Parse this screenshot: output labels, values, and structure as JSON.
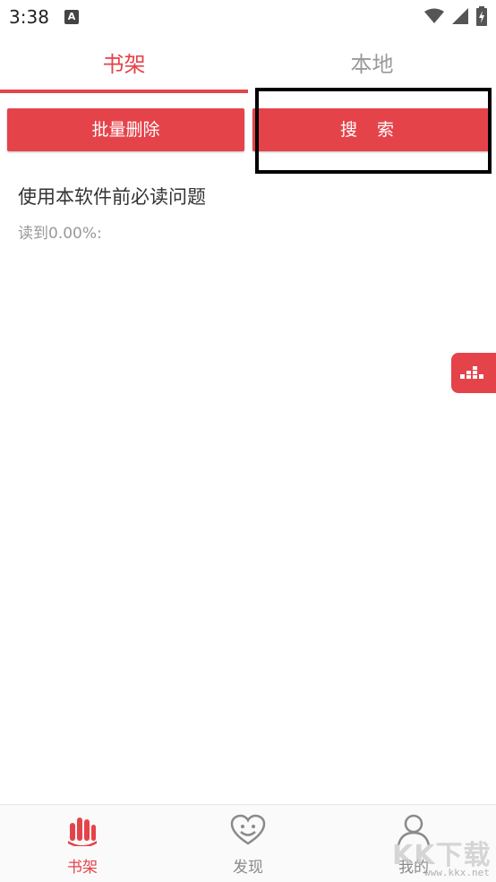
{
  "status_bar": {
    "time": "3:38",
    "notification_badge": "A",
    "icons": [
      "wifi-icon",
      "signal-icon",
      "battery-icon"
    ]
  },
  "tabs": [
    {
      "label": "书架",
      "active": true
    },
    {
      "label": "本地",
      "active": false
    }
  ],
  "actions": {
    "batch_delete_label": "批量删除",
    "search_label": "搜 索"
  },
  "books": [
    {
      "title": "使用本软件前必读问题",
      "progress": "读到0.00%:"
    }
  ],
  "floating_button": {
    "icon": "bars-icon"
  },
  "bottom_nav": [
    {
      "label": "书架",
      "icon": "bookshelf-icon",
      "active": true
    },
    {
      "label": "发现",
      "icon": "heart-smile-icon",
      "active": false
    },
    {
      "label": "我的",
      "icon": "user-icon",
      "active": false
    }
  ],
  "watermark": {
    "text": "KK下载",
    "url": "www.kkx.net"
  },
  "colors": {
    "accent": "#e5434a",
    "inactive": "#9a9a9a",
    "text": "#333333",
    "muted": "#999999"
  }
}
